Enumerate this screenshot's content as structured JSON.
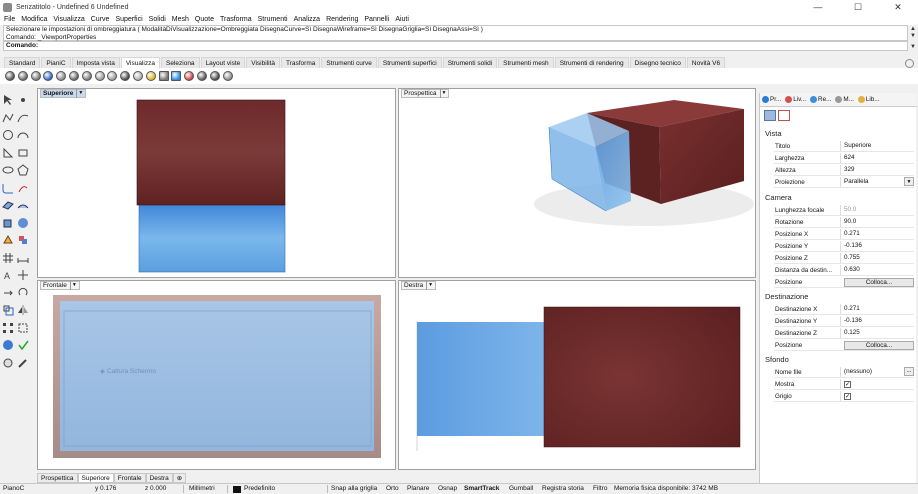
{
  "window": {
    "title": "Senzatitolo - Undefined 6 Undefined",
    "min": "—",
    "max": "☐",
    "close": "✕"
  },
  "menu": [
    "File",
    "Modifica",
    "Visualizza",
    "Curve",
    "Superfici",
    "Solidi",
    "Mesh",
    "Quote",
    "Trasforma",
    "Strumenti",
    "Analizza",
    "Rendering",
    "Pannelli",
    "Aiuti"
  ],
  "command": {
    "history": "Selezionare le impostazioni di ombreggiatura ( ModalitàDiVisualizzazione=Ombreggiata  DisegnaCurve=Sì  DisegnaWireframe=Sì  DisegnaGriglia=Sì  DisegnaAssi=Sì )",
    "history2": "Comando: _ViewportProperties",
    "prompt": "Comando:"
  },
  "toolbar_tabs": [
    "Standard",
    "PianiC",
    "Imposta vista",
    "Visualizza",
    "Seleziona",
    "Layout viste",
    "Visibilità",
    "Trasforma",
    "Strumenti curve",
    "Strumenti superfici",
    "Strumenti solidi",
    "Strumenti mesh",
    "Strumenti di rendering",
    "Disegno tecnico",
    "Novità V6"
  ],
  "active_toolbar_tab": "Visualizza",
  "toolbar_icon_colors": [
    "#555",
    "#666",
    "#777",
    "#2a64c5",
    "#888",
    "#666",
    "#777",
    "#999",
    "#999",
    "#444",
    "#aaa",
    "#e0b020",
    "#777",
    "#2b8be0",
    "#d43c3c",
    "#555",
    "#444",
    "#888"
  ],
  "viewports": {
    "top": {
      "label": "Superiore",
      "watermark": ""
    },
    "perspective": {
      "label": "Prospettica"
    },
    "front": {
      "label": "Frontale",
      "watermark": "Cattura Schermo"
    },
    "right": {
      "label": "Destra"
    }
  },
  "viewport_tabs": [
    "Prospettica",
    "Superiore",
    "Frontale",
    "Destra",
    "⊕"
  ],
  "active_viewport_tab": "Superiore",
  "colors": {
    "box_red": "#6e2a2a",
    "box_blue": "#6aa6de",
    "active_label": "#c9d9f0",
    "frame": "#b59a96"
  },
  "right_panel": {
    "tabs": [
      "Pr...",
      "Liv...",
      "Re...",
      "M...",
      "Lib..."
    ],
    "sections": {
      "vista": "Vista",
      "camera": "Camera",
      "destinazione": "Destinazione",
      "sfondo": "Sfondo"
    },
    "vista_rows": [
      {
        "key": "Titolo",
        "value": "Superiore"
      },
      {
        "key": "Larghezza",
        "value": "624"
      },
      {
        "key": "Altezza",
        "value": "329"
      },
      {
        "key": "Proiezione",
        "value": "Parallela"
      }
    ],
    "camera_rows": [
      {
        "key": "Lunghezza focale",
        "value": "50.0"
      },
      {
        "key": "Rotazione",
        "value": "90.0"
      },
      {
        "key": "Posizione X",
        "value": "0.271"
      },
      {
        "key": "Posizione Y",
        "value": "-0.136"
      },
      {
        "key": "Posizione Z",
        "value": "0.755"
      },
      {
        "key": "Distanza da destin...",
        "value": "0.630"
      },
      {
        "key": "Posizione",
        "value": "Colloca..."
      }
    ],
    "dest_rows": [
      {
        "key": "Destinazione X",
        "value": "0.271"
      },
      {
        "key": "Destinazione Y",
        "value": "-0.136"
      },
      {
        "key": "Destinazione Z",
        "value": "0.125"
      },
      {
        "key": "Posizione",
        "value": "Colloca..."
      }
    ],
    "sfondo_rows": [
      {
        "key": "Nome file",
        "value": "(nessuno)"
      },
      {
        "key": "Mostra",
        "value": ""
      },
      {
        "key": "Grigio",
        "value": ""
      }
    ],
    "ellipsis": "..."
  },
  "status": {
    "cplane": "PianoC",
    "y": "y 0.176",
    "z": "z 0.000",
    "units": "Millimetri",
    "layer": "Predefinito",
    "snap_grid": "Snap alla griglia",
    "orto": "Orto",
    "planare": "Planare",
    "osnap": "Osnap",
    "smarttrack": "SmartTrack",
    "gumball": "Gumball",
    "registra": "Registra storia",
    "filtro": "Filtro",
    "memoria": "Memoria fisica disponibile: 3742 MB"
  }
}
